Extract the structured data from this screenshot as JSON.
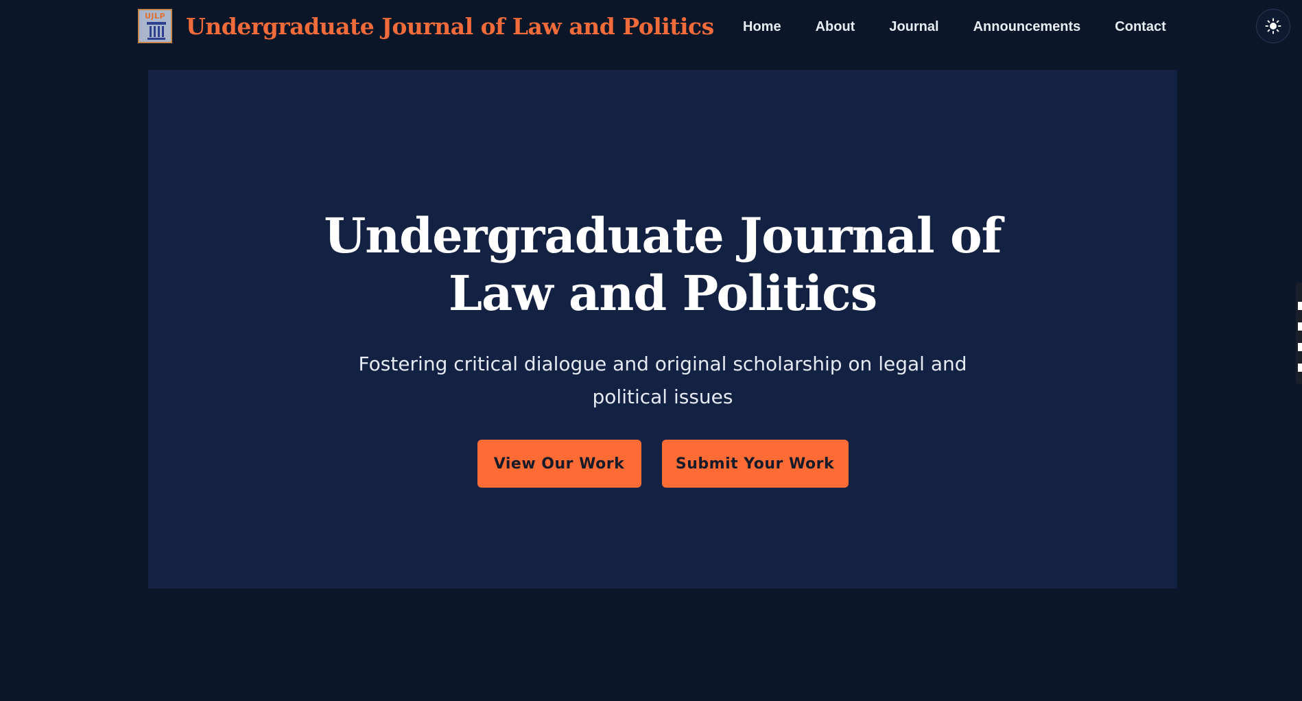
{
  "header": {
    "logo_text": "UJLP",
    "site_title": "Undergraduate Journal of Law and Politics",
    "nav": [
      {
        "label": "Home"
      },
      {
        "label": "About"
      },
      {
        "label": "Journal"
      },
      {
        "label": "Announcements"
      },
      {
        "label": "Contact"
      }
    ],
    "theme_toggle_icon": "sun-icon"
  },
  "hero": {
    "title": "Undergraduate Journal of Law and Politics",
    "subtitle": "Fostering critical dialogue and original scholarship on legal and political issues",
    "primary_button": "View Our Work",
    "secondary_button": "Submit Your Work"
  },
  "colors": {
    "accent": "#ff6b35",
    "background": "#0c172b",
    "hero_background": "#132142",
    "brand_title": "#f26b3a"
  }
}
